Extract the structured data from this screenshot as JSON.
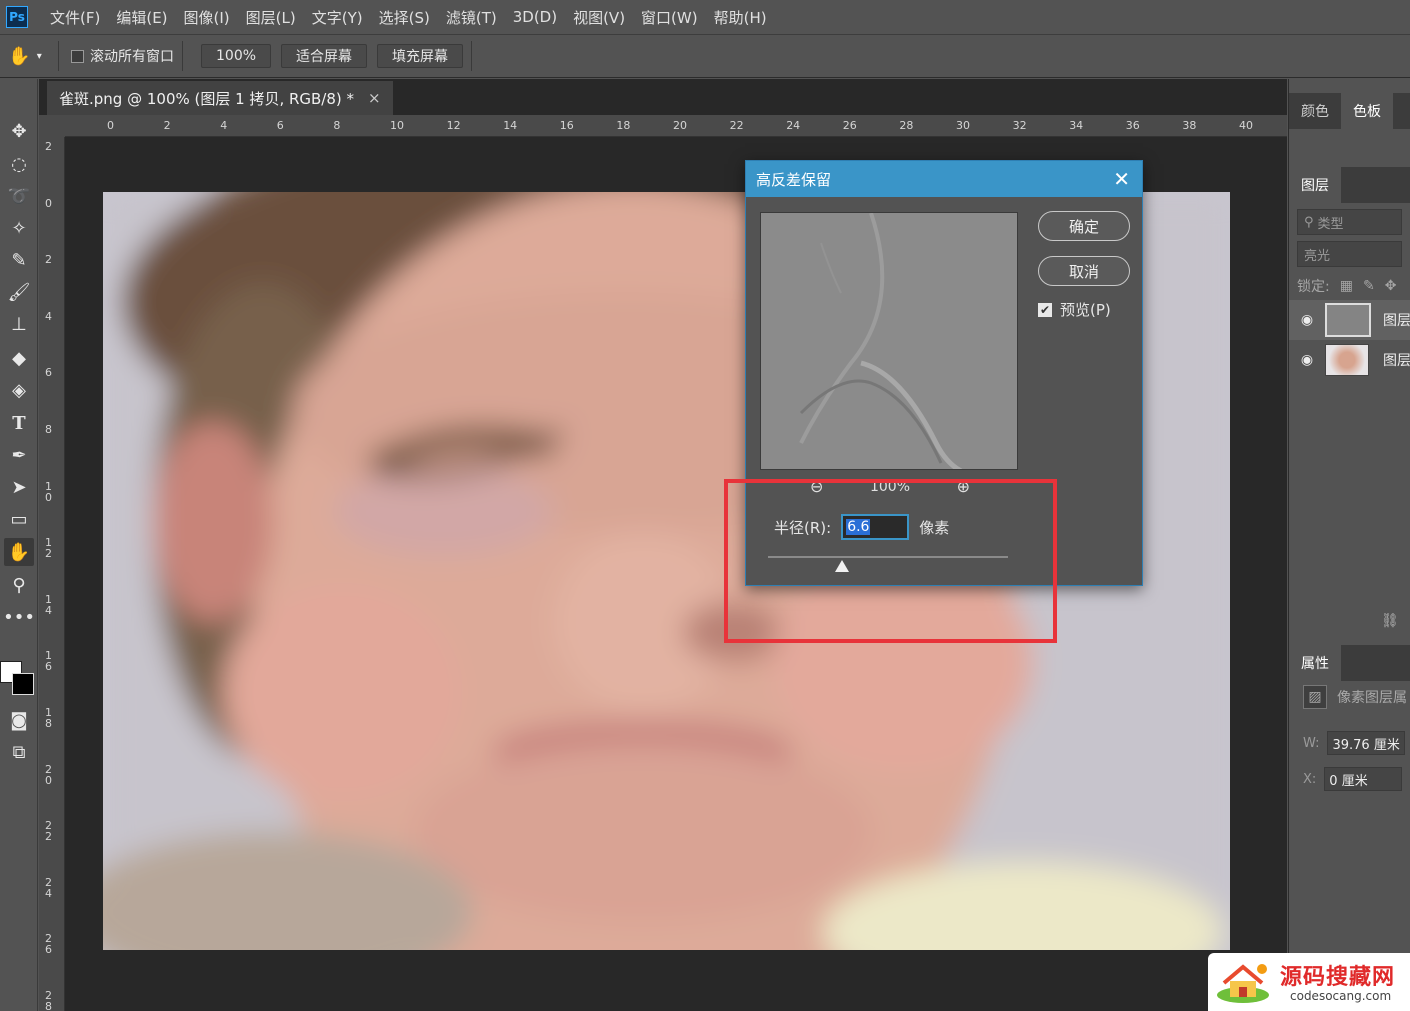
{
  "app": {
    "logo": "Ps"
  },
  "menu": [
    "文件(F)",
    "编辑(E)",
    "图像(I)",
    "图层(L)",
    "文字(Y)",
    "选择(S)",
    "滤镜(T)",
    "3D(D)",
    "视图(V)",
    "窗口(W)",
    "帮助(H)"
  ],
  "options": {
    "scroll_all_label": "滚动所有窗口",
    "zoom_btn": "100%",
    "fit_screen": "适合屏幕",
    "fill_screen": "填充屏幕"
  },
  "document": {
    "tab_title": "雀斑.png @ 100% (图层 1 拷贝, RGB/8) *",
    "close_glyph": "×"
  },
  "rulers": {
    "horizontal": [
      "0",
      "2",
      "4",
      "6",
      "8",
      "10",
      "12",
      "14",
      "16",
      "18",
      "20",
      "22",
      "24",
      "26",
      "28",
      "30",
      "32",
      "34",
      "36",
      "38",
      "40"
    ],
    "vertical": [
      "2",
      "0",
      "2",
      "4",
      "6",
      "8",
      "10",
      "12",
      "14",
      "16",
      "18",
      "20",
      "22",
      "24",
      "26",
      "28"
    ]
  },
  "dialog": {
    "title": "高反差保留",
    "close_glyph": "✕",
    "ok": "确定",
    "cancel": "取消",
    "preview_label": "预览(P)",
    "preview_checked": true,
    "zoom_level": "100%",
    "radius_label": "半径(R):",
    "radius_value": "6.6",
    "radius_unit": "像素",
    "slider_fraction": 0.31
  },
  "right_panel": {
    "tabs_top": [
      "颜色",
      "色板"
    ],
    "layers_tab": "图层",
    "filter_placeholder": "类型",
    "blend_mode": "亮光",
    "lock_label": "锁定:",
    "layers": [
      {
        "name": "图层"
      },
      {
        "name": "图层"
      }
    ],
    "properties_tab": "属性",
    "properties_title": "像素图层属",
    "w_label": "W:",
    "w_value": "39.76 厘米",
    "x_label": "X:",
    "x_value": "0 厘米"
  },
  "watermark": {
    "title": "源码搜藏网",
    "subtitle": "codesocang.com"
  }
}
